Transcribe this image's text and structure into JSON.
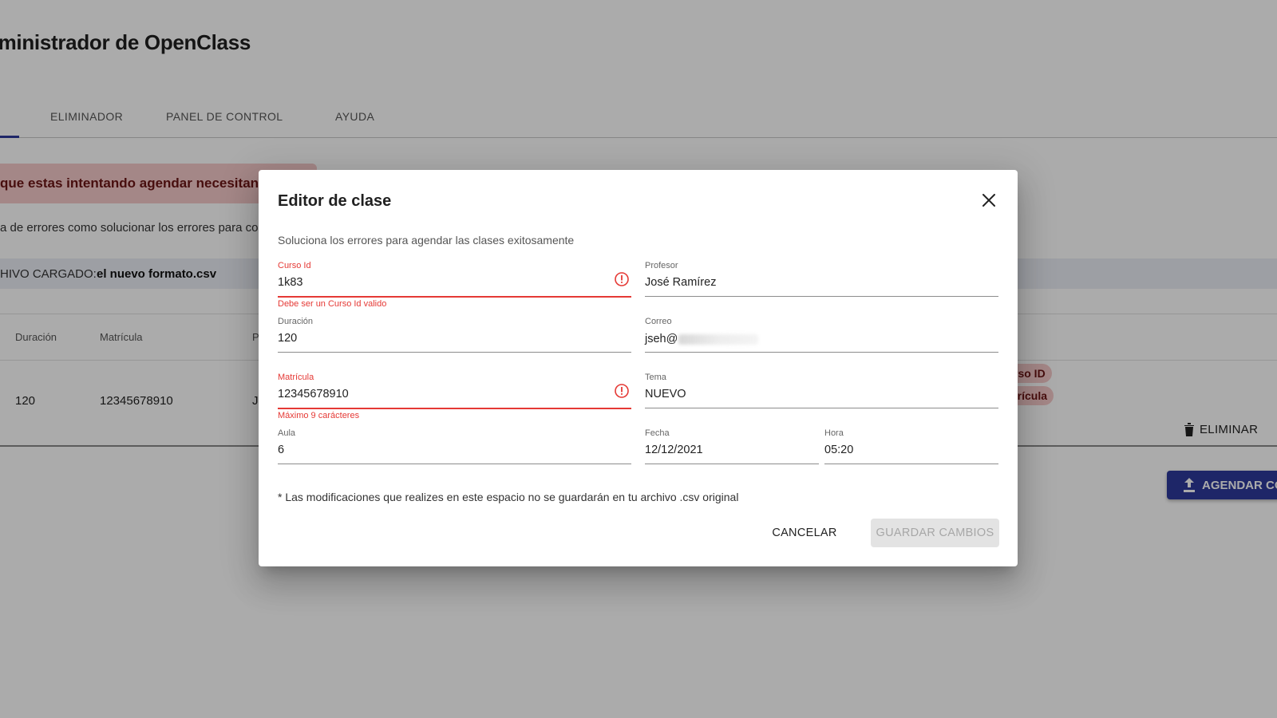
{
  "app": {
    "title": "dministrador de OpenClass"
  },
  "tabs": [
    {
      "label": "ELIMINADOR"
    },
    {
      "label": "PANEL DE CONTROL"
    },
    {
      "label": "AYUDA"
    }
  ],
  "alert": {
    "text": "que estas intentando agendar necesitan corr"
  },
  "hint": {
    "text": "a de errores como solucionar los errores para comp"
  },
  "file": {
    "label": "HIVO CARGADO:",
    "name": "el nuevo formato.csv"
  },
  "table": {
    "headers": [
      "Duración",
      "Matrícula",
      "P"
    ],
    "row": {
      "duracion": "120",
      "matricula": "12345678910",
      "profesor_initial": "J"
    },
    "error_chips": [
      "rso ID",
      "trícula"
    ],
    "delete_label": "ELIMINAR"
  },
  "agendar_button": {
    "label": "AGENDAR CON"
  },
  "dialog": {
    "title": "Editor de clase",
    "subtitle": "Soluciona los errores para agendar las clases exitosamente",
    "fields": {
      "curso_id": {
        "label": "Curso Id",
        "value": "1k83",
        "error": "Debe ser un Curso Id valido"
      },
      "profesor": {
        "label": "Profesor",
        "value": "José Ramírez"
      },
      "duracion": {
        "label": "Duración",
        "value": "120"
      },
      "correo": {
        "label": "Correo",
        "value": "jseh@"
      },
      "matricula": {
        "label": "Matrícula",
        "value": "12345678910",
        "error": "Máximo 9 carácteres"
      },
      "tema": {
        "label": "Tema",
        "value": "NUEVO"
      },
      "aula": {
        "label": "Aula",
        "value": "6"
      },
      "fecha": {
        "label": "Fecha",
        "value": "12/12/2021"
      },
      "hora": {
        "label": "Hora",
        "value": "05:20"
      }
    },
    "note": "* Las modificaciones que realizes en este espacio no se guardarán en tu archivo .csv original",
    "cancel_label": "CANCELAR",
    "save_label": "GUARDAR CAMBIOS"
  },
  "icons": {
    "close": "close-icon",
    "error": "error-outline-icon",
    "delete": "trash-icon",
    "upload": "upload-icon"
  },
  "colors": {
    "primary": "#2d3a9c",
    "error": "#e53935",
    "alert_bg": "#f5c9c9",
    "alert_text": "#6b1515",
    "disabled_bg": "#e3e3e3",
    "disabled_text": "#a7a7a7"
  }
}
